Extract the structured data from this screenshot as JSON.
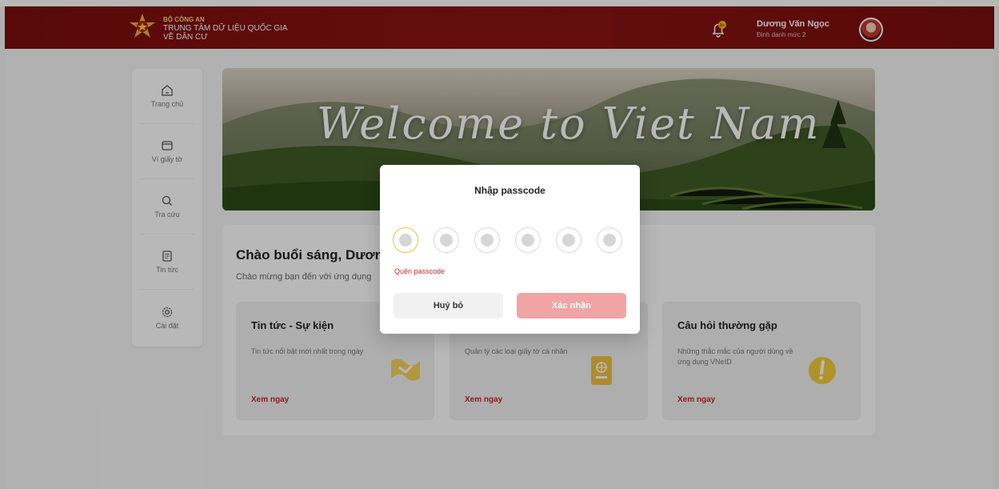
{
  "header": {
    "org_line1": "BỘ CÔNG AN",
    "org_line2": "TRUNG TÂM DỮ LIỆU QUỐC GIA",
    "org_line3": "VỀ DÂN CƯ",
    "user_name": "Dương Văn Ngọc",
    "user_level": "Định danh mức 2"
  },
  "sidebar": {
    "items": [
      {
        "label": "Trang chủ",
        "icon": "home-icon"
      },
      {
        "label": "Ví giấy tờ",
        "icon": "wallet-icon"
      },
      {
        "label": "Tra cứu",
        "icon": "search-icon"
      },
      {
        "label": "Tin tức",
        "icon": "news-icon"
      },
      {
        "label": "Cài đặt",
        "icon": "settings-icon"
      }
    ]
  },
  "banner": {
    "text": "Welcome to Viet Nam"
  },
  "main": {
    "greeting": "Chào buổi sáng, Dương",
    "subtitle": "Chào mừng bạn đến với ứng dụng",
    "cards": [
      {
        "title": "Tin tức - Sự kiện",
        "desc": "Tin tức nổi bật mới nhất trong ngày",
        "link": "Xem ngay",
        "icon": "news-flag-icon"
      },
      {
        "title": "",
        "desc": "Quản lý các loại giấy tờ cá nhân",
        "link": "Xem ngay",
        "icon": "passport-icon"
      },
      {
        "title": "Câu hỏi thường gặp",
        "desc": "Những thắc mắc của người dùng về ứng dụng VNeID",
        "link": "Xem ngay",
        "icon": "exclamation-icon"
      }
    ]
  },
  "modal": {
    "title": "Nhập passcode",
    "forgot": "Quên passcode",
    "cancel": "Huỷ bỏ",
    "confirm": "Xác nhận",
    "digits_total": 6,
    "digits_filled": 0
  },
  "colors": {
    "header_bg": "#7a0d0d",
    "accent_red": "#c62828",
    "confirm_bg": "#f0a4a4",
    "active_digit_ring": "#e6c443"
  }
}
